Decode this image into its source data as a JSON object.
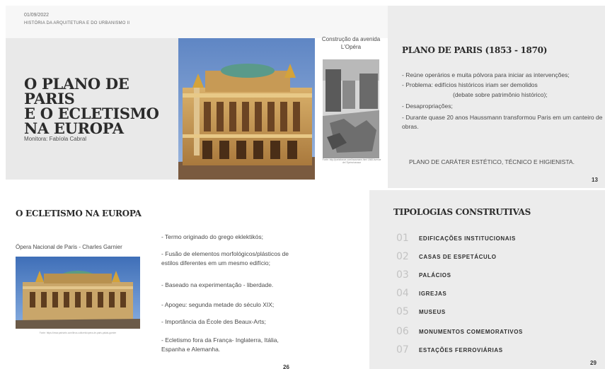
{
  "slide_13": {
    "date": "01/09/2022",
    "course": "HISTÓRIA DA ARQUITETURA E DO URBANISMO II",
    "title_line1": "O PLANO DE PARIS",
    "title_line2": "E O ECLETISMO",
    "title_line3": "NA EUROPA",
    "monitor": "Monitora: Fabíola Cabral",
    "caption_line1": "Construção da avenida",
    "caption_line2": "L'Opéra",
    "photo_credit": "Fonte: http://parisfrance.com/hausmann.html 1868 Avenue de l'Opéra travaux",
    "heading": "PLANO DE PARIS (1853 - 1870)",
    "bullets": [
      "- Reúne operários e muita pólvora para iniciar as intervenções;",
      "- Problema: edifícios históricos iriam ser demolidos",
      "(debate sobre patrimônio histórico);",
      "- Desapropriações;",
      "- Durante quase 20 anos Haussmann transformou Paris em um canteiro de obras."
    ],
    "footer": "PLANO DE CARÁTER ESTÉTICO, TÉCNICO E HIGIENISTA.",
    "page_number": "13"
  },
  "slide_26": {
    "heading": "O ECLETISMO NA EUROPA",
    "photo_caption": "Ópera Nacional de Paris - Charles Garnier",
    "photo_credit": "Fonte: https://www.parisinfo.com/lieux-culturels/opera-de-paris-palais-garnier",
    "bullets": [
      "- Termo originado do grego eklektikós;",
      "- Fusão de elementos morfológicos/plásticos de estilos diferentes em um mesmo edifício;",
      "- Baseado na experimentação - liberdade.",
      "- Apogeu: segunda metade do século XIX;",
      "- Importância da École des Beaux-Arts;",
      "- Ecletismo fora da França- Inglaterra, Itália, Espanha e Alemanha."
    ],
    "page_number": "26"
  },
  "slide_29": {
    "heading": "TIPOLOGIAS CONSTRUTIVAS",
    "items": [
      {
        "num": "01",
        "label": "EDIFICAÇÕES INSTITUCIONAIS"
      },
      {
        "num": "02",
        "label": "CASAS DE ESPETÁCULO"
      },
      {
        "num": "03",
        "label": "PALÁCIOS"
      },
      {
        "num": "04",
        "label": "IGREJAS"
      },
      {
        "num": "05",
        "label": "MUSEUS"
      },
      {
        "num": "06",
        "label": "MONUMENTOS COMEMORATIVOS"
      },
      {
        "num": "07",
        "label": "ESTAÇÕES FERROVIÁRIAS"
      }
    ],
    "page_number": "29"
  },
  "colors": {
    "panel_gray": "#e9e9e9",
    "slide_gray": "#ececec",
    "title_text": "#2b2b2b",
    "number_gray": "#c3c3c3"
  }
}
